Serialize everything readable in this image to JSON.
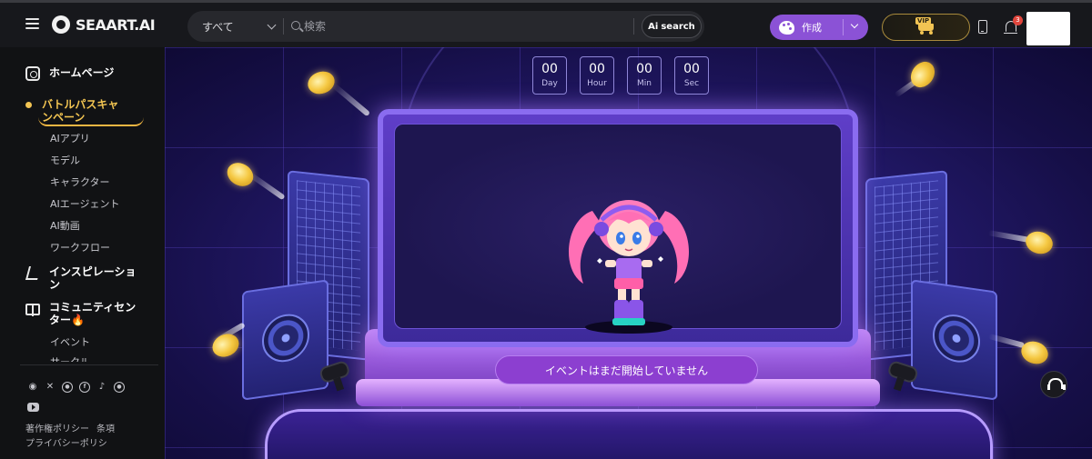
{
  "header": {
    "logo_text": "SEAART.AI",
    "search": {
      "scope_value": "すべて",
      "placeholder": "検索",
      "ai_search_prefix": "Ai",
      "ai_search_label": "search"
    },
    "create_label": "作成",
    "vip_label": "VIP",
    "notification_count": "3"
  },
  "sidebar": {
    "home": "ホームページ",
    "battle_pass": "バトルパスキャンペーン",
    "sub_items": [
      "AIアプリ",
      "モデル",
      "キャラクター",
      "AIエージェント",
      "AI動画",
      "ワークフロー"
    ],
    "inspiration": "インスピレーション",
    "community": "コミュニティセンター",
    "community_fire": "🔥",
    "community_sub": [
      "イベント",
      "サークル"
    ],
    "footer": {
      "copyright_policy": "著作権ポリシー",
      "terms": "条項",
      "privacy": "プライバシーポリシ"
    }
  },
  "event": {
    "countdown": [
      {
        "value": "00",
        "label": "Day"
      },
      {
        "value": "00",
        "label": "Hour"
      },
      {
        "value": "00",
        "label": "Min"
      },
      {
        "value": "00",
        "label": "Sec"
      }
    ],
    "status_button": "イベントはまだ開始していません"
  },
  "colors": {
    "accent_purple": "#8b52d6",
    "battle_gold": "#f4c652",
    "stage_bg": "#241a6e"
  }
}
